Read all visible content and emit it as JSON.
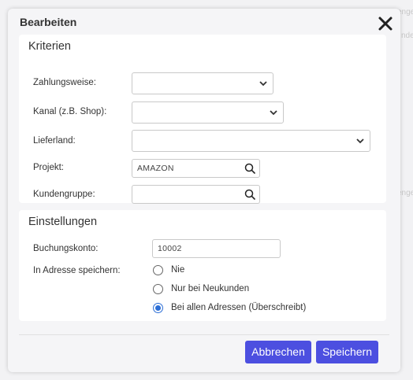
{
  "background": {
    "fragment_1": "enge",
    "fragment_2": "nde",
    "fragment_3": "enge"
  },
  "dialog": {
    "title": "Bearbeiten",
    "close_icon": "close-icon"
  },
  "criteria": {
    "title": "Kriterien",
    "payment": {
      "label": "Zahlungsweise:",
      "value": ""
    },
    "channel": {
      "label": "Kanal (z.B. Shop):",
      "value": ""
    },
    "country": {
      "label": "Lieferland:",
      "value": ""
    },
    "project": {
      "label": "Projekt:",
      "value": "AMAZON"
    },
    "customer_group": {
      "label": "Kundengruppe:",
      "value": ""
    }
  },
  "settings": {
    "title": "Einstellungen",
    "account": {
      "label": "Buchungskonto:",
      "value": "10002"
    },
    "save_in_address": {
      "label": "In Adresse speichern:",
      "options": [
        {
          "label": "Nie",
          "checked": false
        },
        {
          "label": "Nur bei Neukunden",
          "checked": false
        },
        {
          "label": "Bei allen Adressen (Überschreibt)",
          "checked": true
        }
      ]
    }
  },
  "buttons": {
    "cancel": "Abbrechen",
    "save": "Speichern"
  },
  "colors": {
    "accent": "#4c4fe0",
    "radio_checked": "#2d6fd6"
  }
}
